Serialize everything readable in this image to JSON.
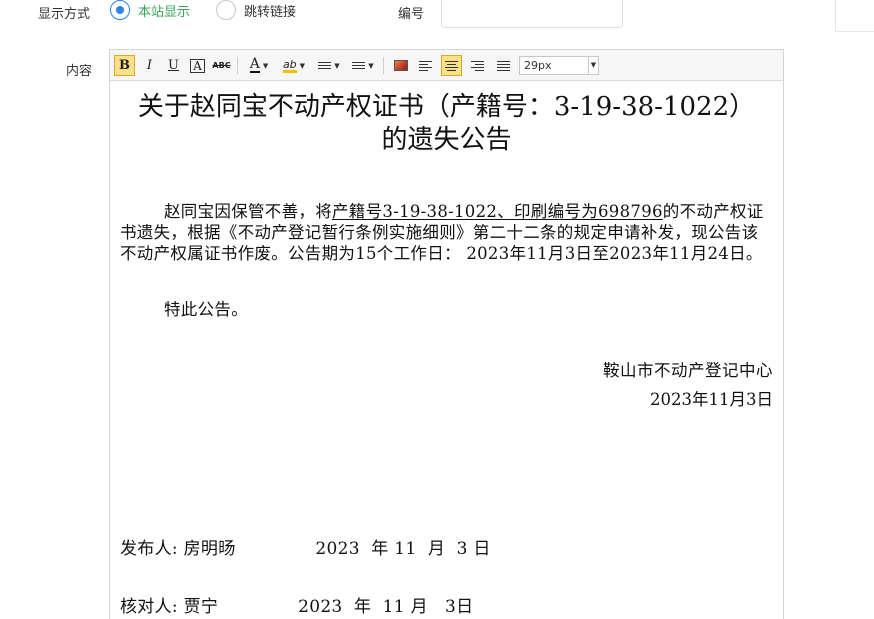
{
  "form": {
    "display_label": "显示方式",
    "radio_site": "本站显示",
    "radio_link": "跳转链接",
    "number_label": "编号",
    "number_value": "",
    "content_label": "内容"
  },
  "toolbar": {
    "bold": "B",
    "italic": "I",
    "underline": "U",
    "box_a": "A",
    "strike": "ABC",
    "font_color": "A",
    "highlight": "ab",
    "font_size": "29px"
  },
  "document": {
    "title": "关于赵同宝不动产权证书（产籍号：3-19-38-1022）的遗失公告",
    "p1_a": "赵同宝因保管不善，将",
    "p1_u": "产籍号3-19-38-1022、印刷编号为698796",
    "p1_b": "的不动产权证书遗失，根据《不动产登记暂行条例实施细则》第二十二条的规定申请补发，现公告该不动产权属证书作废。公告期为15个工作日： 2023年11月3日至2023年11月24日。",
    "p2": "特此公告。",
    "sign_org": "鞍山市不动产登记中心",
    "sign_date": "2023年11月3日",
    "publisher_line": "发布人: 房明旸              2023  年 11  月  3 日",
    "checker_line": "核对人: 贾宁              2023  年  11 月   3日"
  }
}
